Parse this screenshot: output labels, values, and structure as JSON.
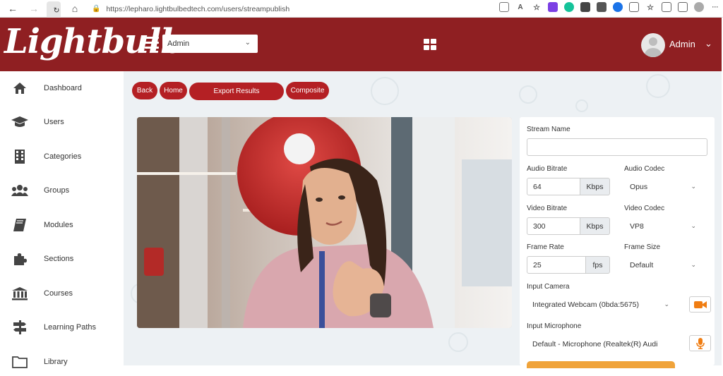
{
  "browser": {
    "url": "https://lepharo.lightbulbedtech.com/users/streampublish"
  },
  "header": {
    "logo_text": "Lightbulb",
    "role_select": "Admin",
    "user_name": "Admin"
  },
  "sidebar": {
    "items": [
      {
        "label": "Dashboard",
        "icon": "home-icon"
      },
      {
        "label": "Users",
        "icon": "graduation-cap-icon"
      },
      {
        "label": "Categories",
        "icon": "building-icon"
      },
      {
        "label": "Groups",
        "icon": "users-icon"
      },
      {
        "label": "Modules",
        "icon": "book-icon"
      },
      {
        "label": "Sections",
        "icon": "puzzle-icon"
      },
      {
        "label": "Courses",
        "icon": "institution-icon"
      },
      {
        "label": "Learning Paths",
        "icon": "signpost-icon"
      },
      {
        "label": "Library",
        "icon": "folder-icon"
      }
    ]
  },
  "toolbar": {
    "back": "Back",
    "home": "Home",
    "export": "Export Results",
    "composite": "Composite"
  },
  "form": {
    "stream_name_label": "Stream Name",
    "stream_name_value": "",
    "audio_bitrate_label": "Audio Bitrate",
    "audio_bitrate_value": "64",
    "audio_bitrate_unit": "Kbps",
    "audio_codec_label": "Audio Codec",
    "audio_codec_value": "Opus",
    "video_bitrate_label": "Video Bitrate",
    "video_bitrate_value": "300",
    "video_bitrate_unit": "Kbps",
    "video_codec_label": "Video Codec",
    "video_codec_value": "VP8",
    "frame_rate_label": "Frame Rate",
    "frame_rate_value": "25",
    "frame_rate_unit": "fps",
    "frame_size_label": "Frame Size",
    "frame_size_value": "Default",
    "input_camera_label": "Input Camera",
    "input_camera_value": "Integrated Webcam (0bda:5675)",
    "input_mic_label": "Input Microphone",
    "input_mic_value": "Default - Microphone (Realtek(R) Audi"
  },
  "colors": {
    "brand": "#8f1f22",
    "button": "#b42024",
    "accent": "#f0a33a"
  }
}
